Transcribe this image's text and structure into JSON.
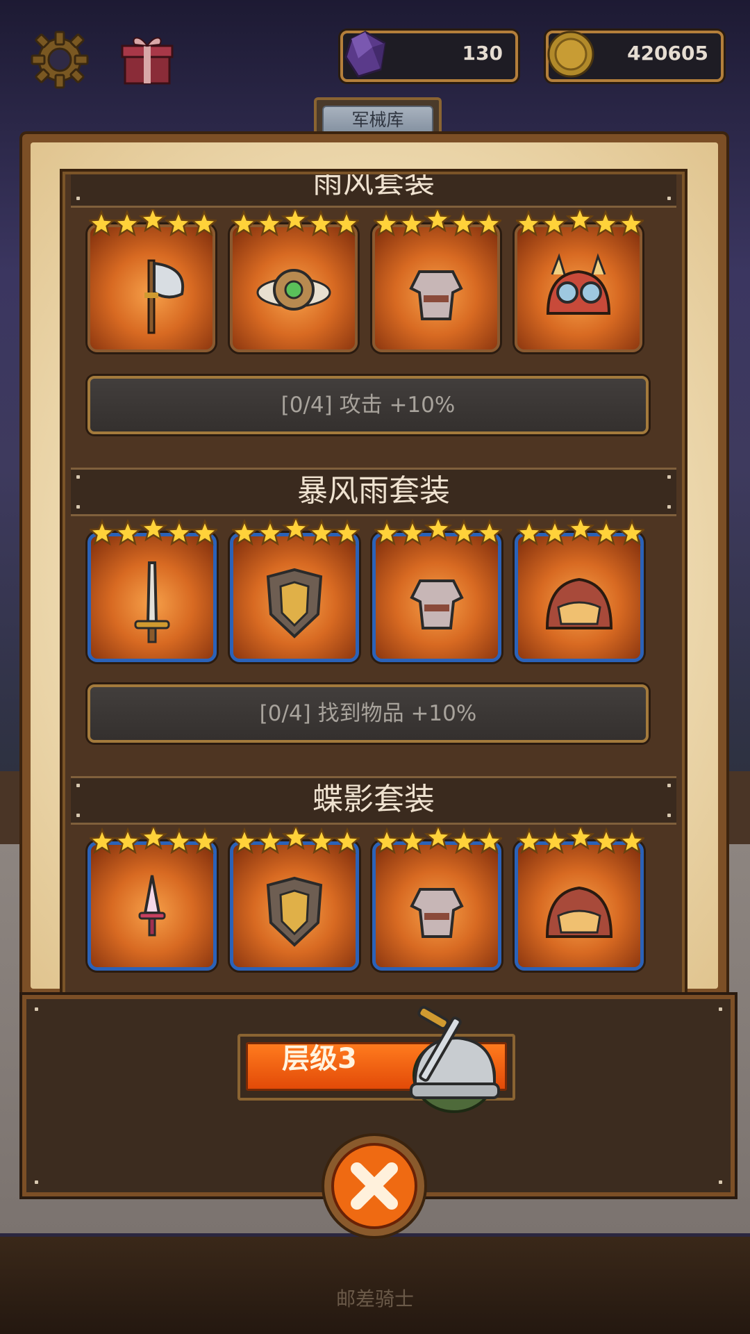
{
  "hud": {
    "gems": "130",
    "coins": "420605",
    "settings_icon": "gear-icon",
    "gift_icon": "gift-icon"
  },
  "tab": {
    "title": "军械库"
  },
  "sets": [
    {
      "name": "雨风套装",
      "bonus": "[0/4] 攻击 +10%",
      "frame": "orange",
      "items": [
        "axe-icon",
        "amulet-icon",
        "armor-icon",
        "goggles-helmet-icon"
      ],
      "stars": 5
    },
    {
      "name": "暴风雨套装",
      "bonus": "[0/4] 找到物品 +10%",
      "frame": "blue",
      "items": [
        "sword-icon",
        "shield-icon",
        "armor-icon",
        "helmet-icon"
      ],
      "stars": 5
    },
    {
      "name": "蝶影套装",
      "bonus": "",
      "frame": "blue",
      "items": [
        "dagger-icon",
        "shield-icon",
        "armor-icon",
        "helmet-icon"
      ],
      "stars": 5
    }
  ],
  "footer": {
    "level_label": "层级3"
  },
  "background_label": "邮差骑士",
  "colors": {
    "panel_brown": "#7c4f26",
    "blue_frame": "#2b62b8",
    "level_orange": "#ff7b1e"
  }
}
